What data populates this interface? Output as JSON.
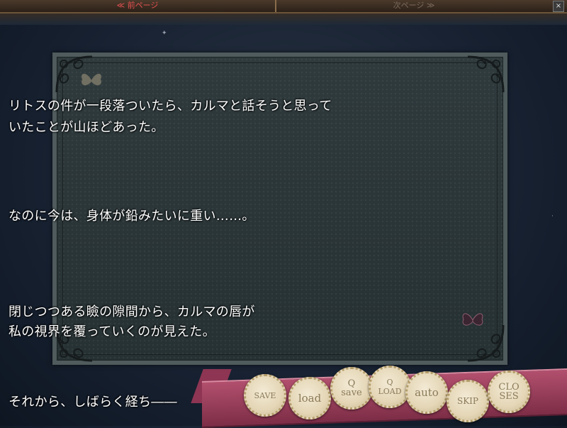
{
  "topbar": {
    "prev_label": "≪ 前ページ",
    "next_label": "次ページ ≫",
    "close_label": "×"
  },
  "text": {
    "lines": [
      "リトスの件が一段落ついたら、カルマと話そうと思って",
      "いたことが山ほどあった。",
      "なのに今は、身体が鉛みたいに重い……。",
      "閉じつつある瞼の隙間から、カルマの唇が",
      "私の視界を覆っていくのが見えた。",
      "それから、しばらく経ち――"
    ]
  },
  "buttons": {
    "save": "SAVE",
    "load": "load",
    "qsave_top": "Q",
    "qsave_bottom": "save",
    "qload_top": "Q",
    "qload_bottom": "LOAD",
    "auto": "auto",
    "skip": "SKIP",
    "close_top": "CLO",
    "close_bottom": "SES"
  },
  "colors": {
    "accent_prev": "#e05050",
    "ribbon": "#a9486a",
    "medal": "#e9dcbc"
  }
}
